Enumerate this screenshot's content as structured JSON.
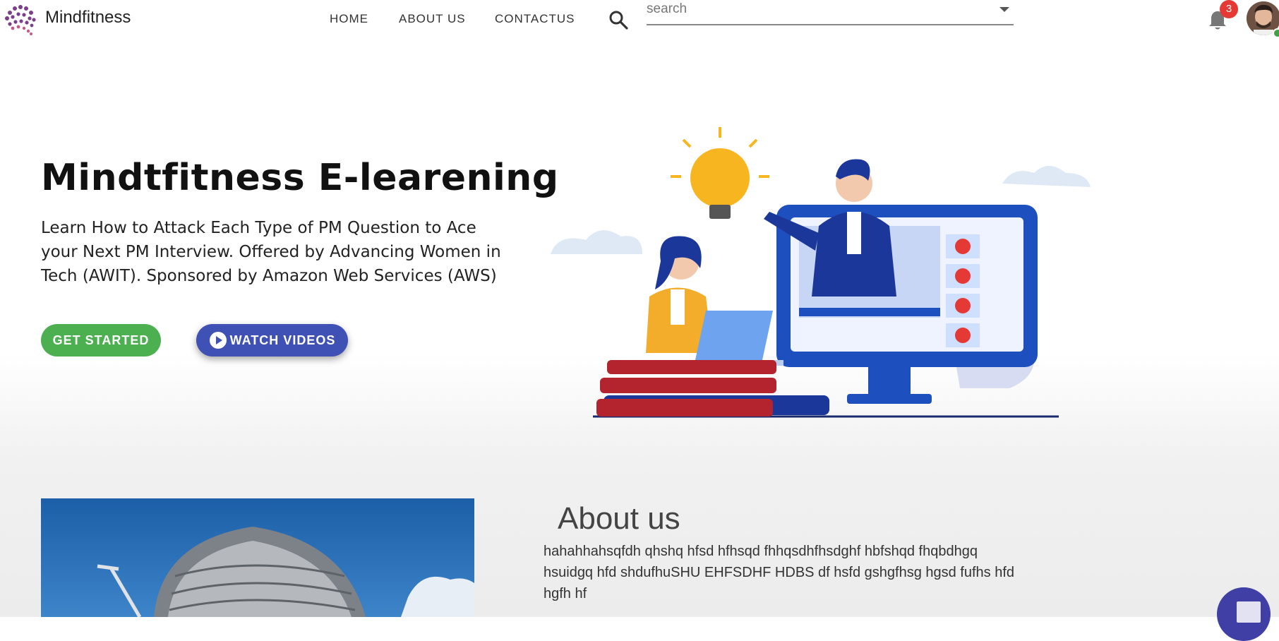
{
  "header": {
    "brand": "Mindfitness",
    "nav": [
      "HOME",
      "ABOUT US",
      "CONTACTUS"
    ],
    "search_placeholder": "search",
    "notification_count": "3"
  },
  "hero": {
    "title": "Mindtfitness E-learening",
    "description": "Learn How to Attack Each Type of PM Question to Ace your Next PM Interview. Offered by Advancing Women in Tech (AWIT). Sponsored by Amazon Web Services (AWS)",
    "btn_start": "GET STARTED",
    "btn_watch": "WATCH VIDEOS"
  },
  "about": {
    "title": "About us",
    "text": "hahahhahsqfdh qhshq hfsd hfhsqd fhhqsdhfhsdghf hbfshqd fhqbdhgq hsuidgq hfd shdufhuSHU EHFSDHF HDBS df hsfd gshgfhsg hgsd fufhs hfd hgfh hf"
  },
  "colors": {
    "primary": "#3f51b5",
    "success": "#4caf50",
    "badge": "#e53935"
  }
}
